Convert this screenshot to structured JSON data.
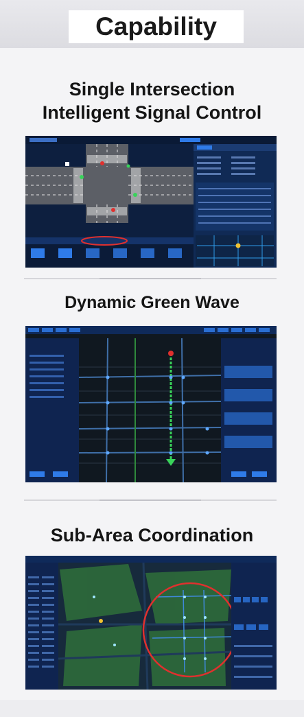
{
  "header": {
    "title": "Capability"
  },
  "sections": [
    {
      "title_line1": "Single Intersection",
      "title_line2": "Intelligent Signal Control"
    },
    {
      "title": "Dynamic Green Wave"
    },
    {
      "title": "Sub-Area Coordination"
    }
  ],
  "colors": {
    "dark_bg": "#0b1d3a",
    "accent_blue": "#2f7be8",
    "signal_red": "#e0302e",
    "signal_green": "#39d35a",
    "map_green": "#2e6b3a"
  }
}
